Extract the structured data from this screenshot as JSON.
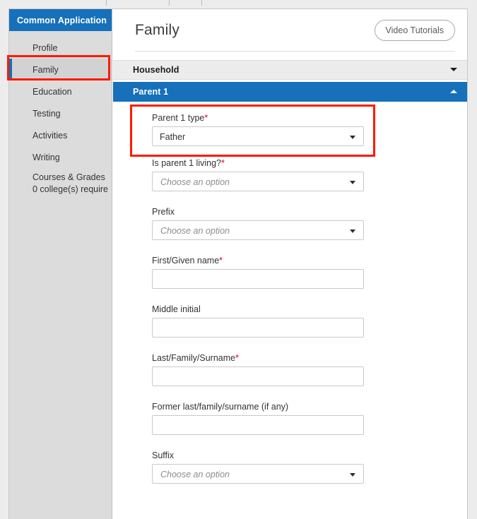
{
  "app": {
    "window_title": "Common Application"
  },
  "sidebar": {
    "header_label": "Common Application",
    "items": [
      {
        "label": "Profile",
        "active": false
      },
      {
        "label": "Family",
        "active": true
      },
      {
        "label": "Education",
        "active": false
      },
      {
        "label": "Testing",
        "active": false
      },
      {
        "label": "Activities",
        "active": false
      },
      {
        "label": "Writing",
        "active": false
      },
      {
        "label": "Courses & Grades",
        "sub": "0 college(s) require",
        "active": false
      }
    ]
  },
  "header": {
    "page_title": "Family",
    "video_tutorials_label": "Video Tutorials"
  },
  "sections": [
    {
      "label": "Household",
      "state": "collapsed",
      "icon": "chevron-down-icon"
    },
    {
      "label": "Parent 1",
      "state": "expanded",
      "icon": "chevron-up-icon"
    }
  ],
  "form": {
    "fields": [
      {
        "name": "parent-1-type",
        "label": "Parent 1 type",
        "required": true,
        "type": "select",
        "value": "Father",
        "placeholder": ""
      },
      {
        "name": "is-parent-1-living",
        "label": "Is parent 1 living?",
        "required": true,
        "type": "select",
        "value": "",
        "placeholder": "Choose an option"
      },
      {
        "name": "prefix",
        "label": "Prefix",
        "required": false,
        "type": "select",
        "value": "",
        "placeholder": "Choose an option"
      },
      {
        "name": "first-given-name",
        "label": "First/Given name",
        "required": true,
        "type": "text",
        "value": "",
        "placeholder": ""
      },
      {
        "name": "middle-initial",
        "label": "Middle initial",
        "required": false,
        "type": "text",
        "value": "",
        "placeholder": ""
      },
      {
        "name": "last-family-surname",
        "label": "Last/Family/Surname",
        "required": true,
        "type": "text",
        "value": "",
        "placeholder": ""
      },
      {
        "name": "former-last-family-surname",
        "label": "Former last/family/surname (if any)",
        "required": false,
        "type": "text",
        "value": "",
        "placeholder": ""
      },
      {
        "name": "suffix",
        "label": "Suffix",
        "required": false,
        "type": "select",
        "value": "",
        "placeholder": "Choose an option"
      }
    ],
    "required_marker": "*"
  },
  "annotations": [
    {
      "name": "highlight-sidebar-family",
      "color": "#ff1a00"
    },
    {
      "name": "highlight-parent-1-type",
      "color": "#ff1a00"
    }
  ],
  "colors": {
    "brand_blue": "#1670ba",
    "sidebar_gray": "#dcdcdc",
    "active_item_gray": "#d2d2d2",
    "section_collapsed_gray": "#ececec",
    "required_red": "#d0021b",
    "annotation_red": "#ff1a00"
  }
}
